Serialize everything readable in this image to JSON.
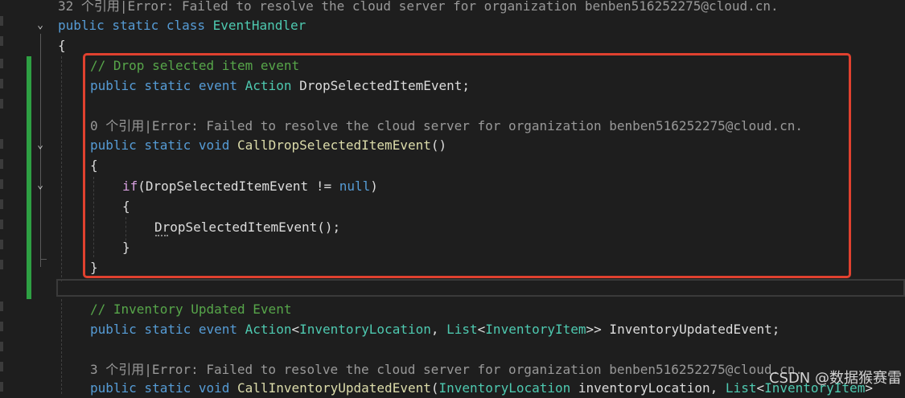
{
  "code_lens": {
    "class_refs": "32 个引用|Error: Failed to resolve the cloud server for organization benben516252275@cloud.cn.",
    "call_drop_refs": "0 个引用|Error: Failed to resolve the cloud server for organization benben516252275@cloud.cn.",
    "call_inventory_refs": "3 个引用|Error: Failed to resolve the cloud server for organization benben516252275@cloud.cn."
  },
  "code": {
    "l1_kw": "public static class ",
    "l1_type": "EventHandler",
    "l2": "{",
    "c1": "// Drop selected item event",
    "l3_kw": "public static event ",
    "l3_type": "Action",
    "l3_rest": " DropSelectedItemEvent;",
    "l4_kw": "public static void ",
    "l4_fn": "CallDropSelectedItemEvent",
    "l4_rest": "()",
    "l5": "{",
    "l6_if": "if",
    "l6_mid": "(DropSelectedItemEvent != ",
    "l6_null": "null",
    "l6_end": ")",
    "l7": "{",
    "l8": "DropSelectedItemEvent();",
    "l9": "}",
    "l10": "}",
    "c2": "// Inventory Updated Event",
    "l11_kw": "public static event ",
    "l11_type1": "Action",
    "l11_p1": "<",
    "l11_type2": "InventoryLocation",
    "l11_p2": ", ",
    "l11_type3": "List",
    "l11_p3": "<",
    "l11_type4": "InventoryItem",
    "l11_p4": ">> InventoryUpdatedEvent;",
    "l12_kw": "public static void ",
    "l12_fn": "CallInventoryUpdatedEvent",
    "l12_p1": "(",
    "l12_type1": "InventoryLocation",
    "l12_p2": " inventoryLocation, ",
    "l12_type2": "List",
    "l12_p3": "<",
    "l12_type3": "InventoryItem",
    "l12_p4": ">"
  },
  "watermark": "CSDN @数据猴赛雷",
  "colors": {
    "keyword": "#569cd6",
    "type": "#4ec9b0",
    "function": "#dcdcaa",
    "comment": "#57a64a",
    "highlight_box": "#e0412f",
    "change_bar": "#2ea043"
  }
}
